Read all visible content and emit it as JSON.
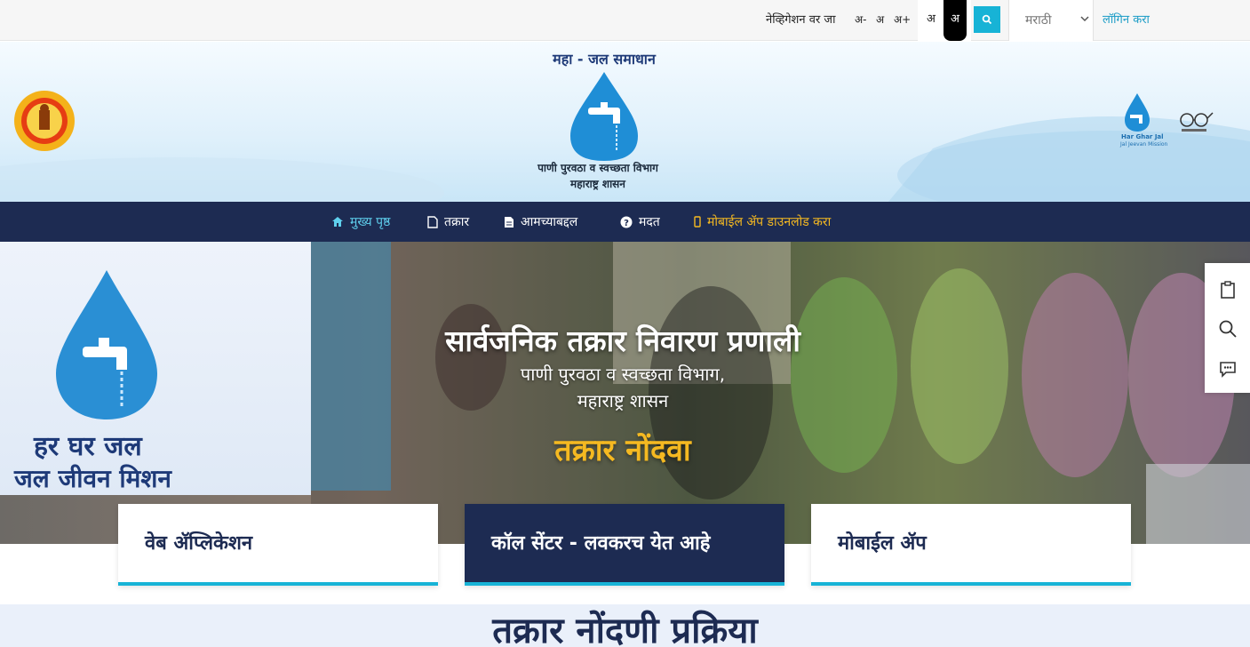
{
  "topbar": {
    "skip_link": "नेव्हिगेशन वर जा",
    "font_decrease": "अ-",
    "font_normal": "अ",
    "font_increase": "अ+",
    "contrast_light": "अ",
    "contrast_dark": "अ",
    "language_selected": "मराठी",
    "login": "लॉगिन करा"
  },
  "header": {
    "logo_name": "महा - जल समाधान",
    "department": "पाणी पुरवठा व स्वच्छता विभाग",
    "government": "महाराष्ट्र शासन",
    "har_ghar_jal": "Har Ghar Jal",
    "jal_jeevan_mission": "Jal Jeevan Mission"
  },
  "nav": {
    "items": [
      {
        "label": "मुख्य पृष्ठ",
        "icon": "home-icon"
      },
      {
        "label": "तक्रार",
        "icon": "file-icon"
      },
      {
        "label": "आमच्याबद्दल",
        "icon": "document-icon"
      },
      {
        "label": "मदत",
        "icon": "help-icon"
      },
      {
        "label": "मोबाईल ॲप डाउनलोड करा",
        "icon": "mobile-icon"
      }
    ]
  },
  "hero": {
    "title": "सार्वजनिक तक्रार निवारण प्रणाली",
    "subtitle_line1": "पाणी पुरवठा व स्वच्छता विभाग,",
    "subtitle_line2": "महाराष्ट्र शासन",
    "cta": "तक्रार नोंदवा",
    "side_line1": "हर घर जल",
    "side_line2": "जल जीवन मिशन"
  },
  "cards": [
    {
      "label": "वेब ॲप्लिकेशन"
    },
    {
      "label": "कॉल सेंटर - लवकरच येत आहे"
    },
    {
      "label": "मोबाईल ॲप"
    }
  ],
  "process": {
    "title": "तक्रार नोंदणी प्रक्रिया"
  },
  "colors": {
    "navy": "#1d2b52",
    "cyan": "#17b3d6",
    "amber": "#f5b921"
  }
}
